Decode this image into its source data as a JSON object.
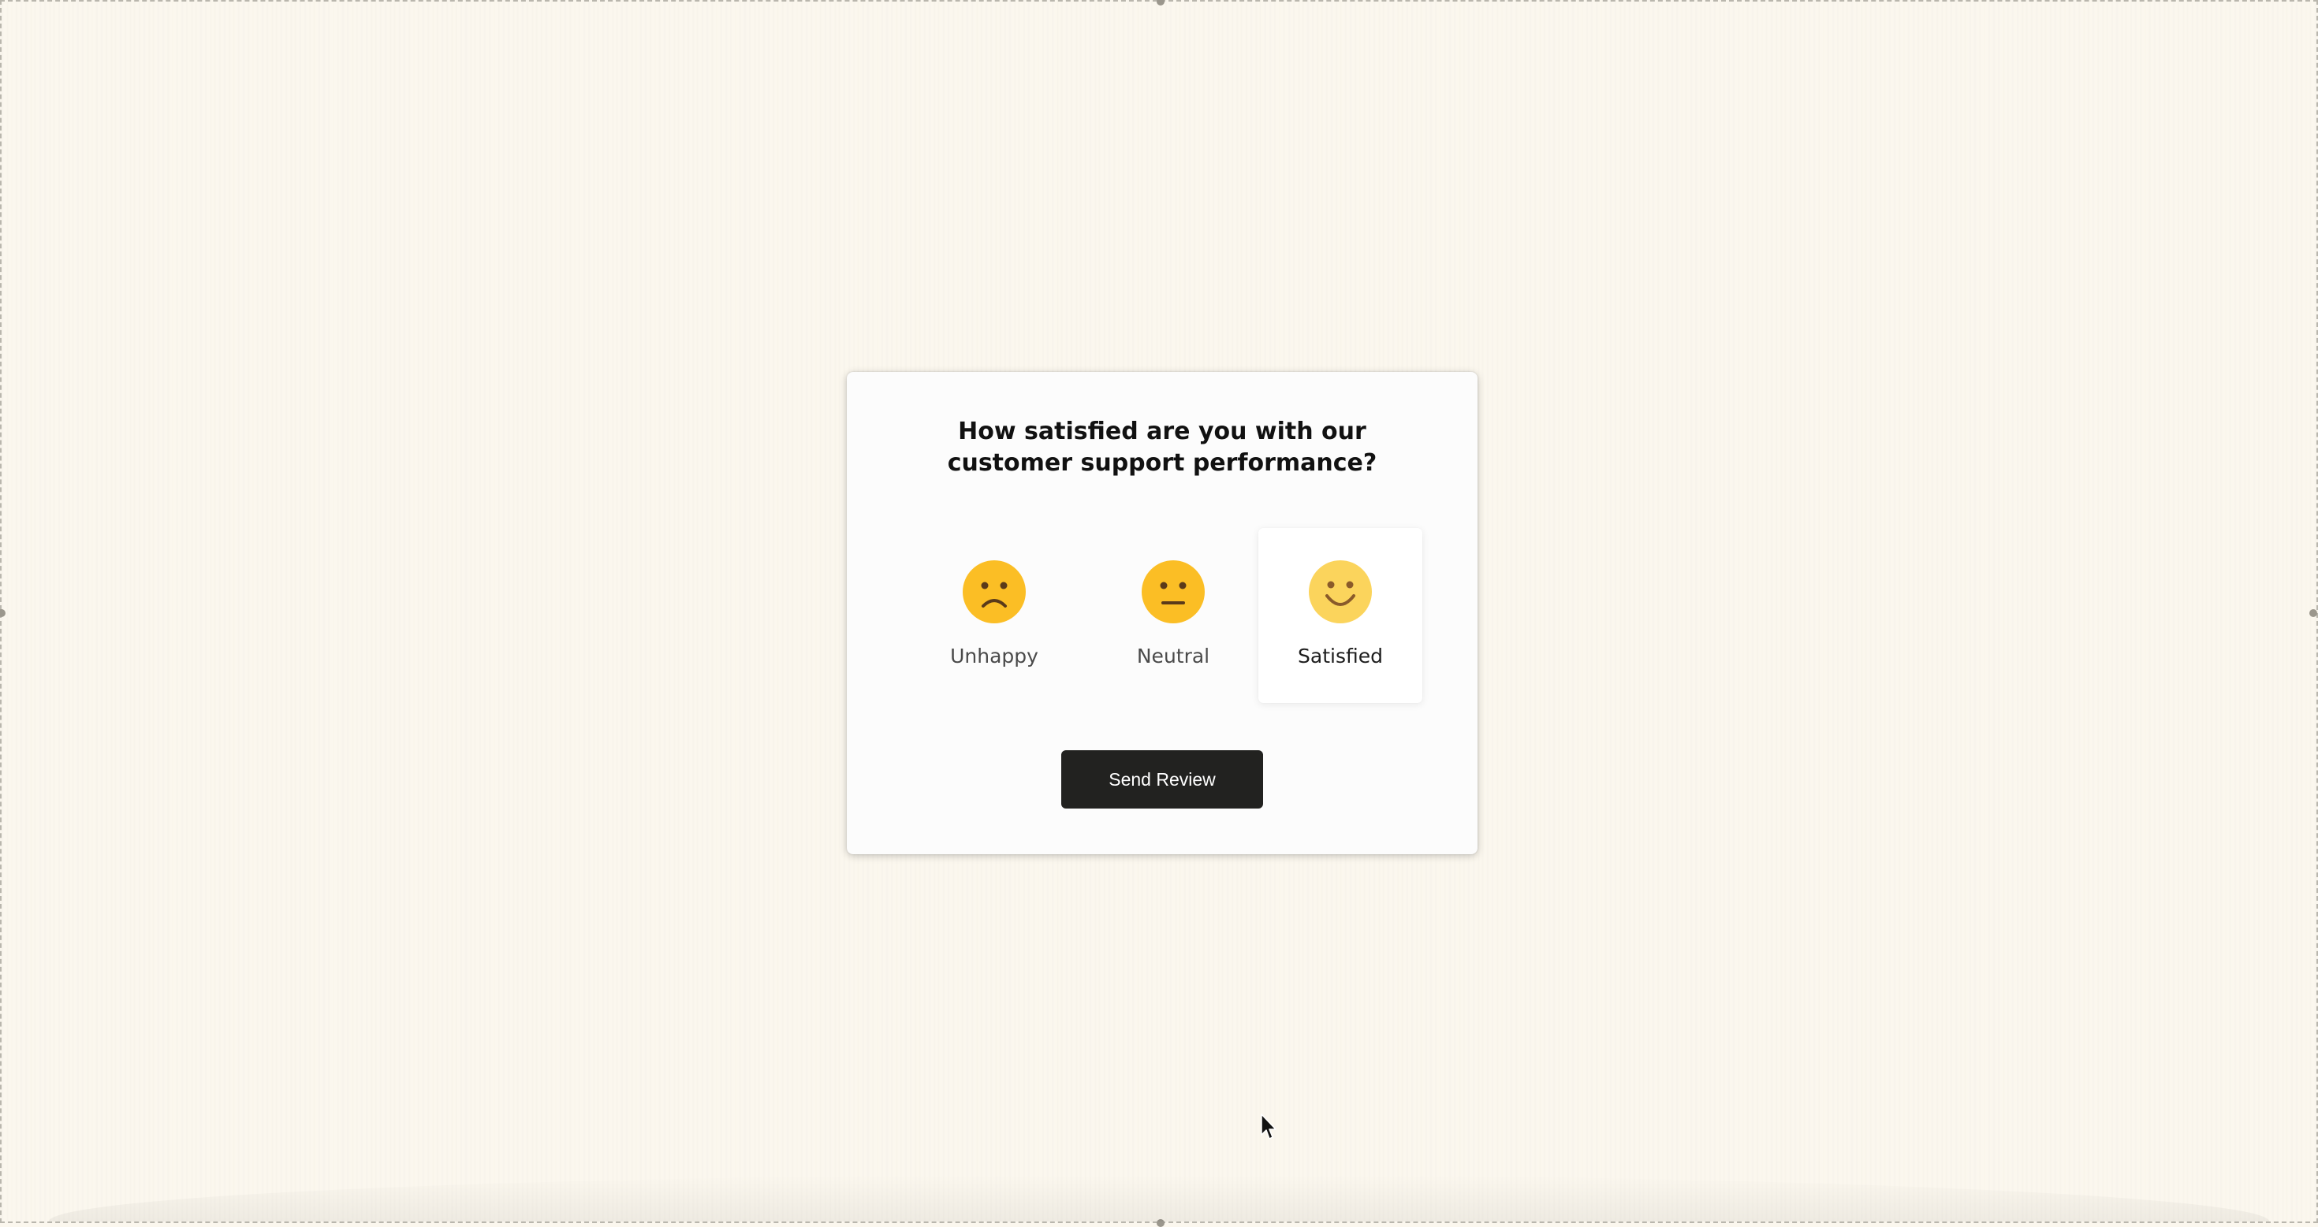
{
  "survey": {
    "question_line1": "How satisfied are you with our",
    "question_line2": "customer support performance?",
    "options": [
      {
        "label": "Unhappy",
        "icon": "sad-face-icon",
        "selected": false
      },
      {
        "label": "Neutral",
        "icon": "neutral-face-icon",
        "selected": false
      },
      {
        "label": "Satisfied",
        "icon": "smiling-face-icon",
        "selected": true
      }
    ],
    "submit_label": "Send Review"
  },
  "colors": {
    "background": "#fbf7ee",
    "card": "#fcfcfc",
    "emoji_yellow": "#fbbe25",
    "emoji_selected": "#fbd45c",
    "button": "#222220"
  }
}
